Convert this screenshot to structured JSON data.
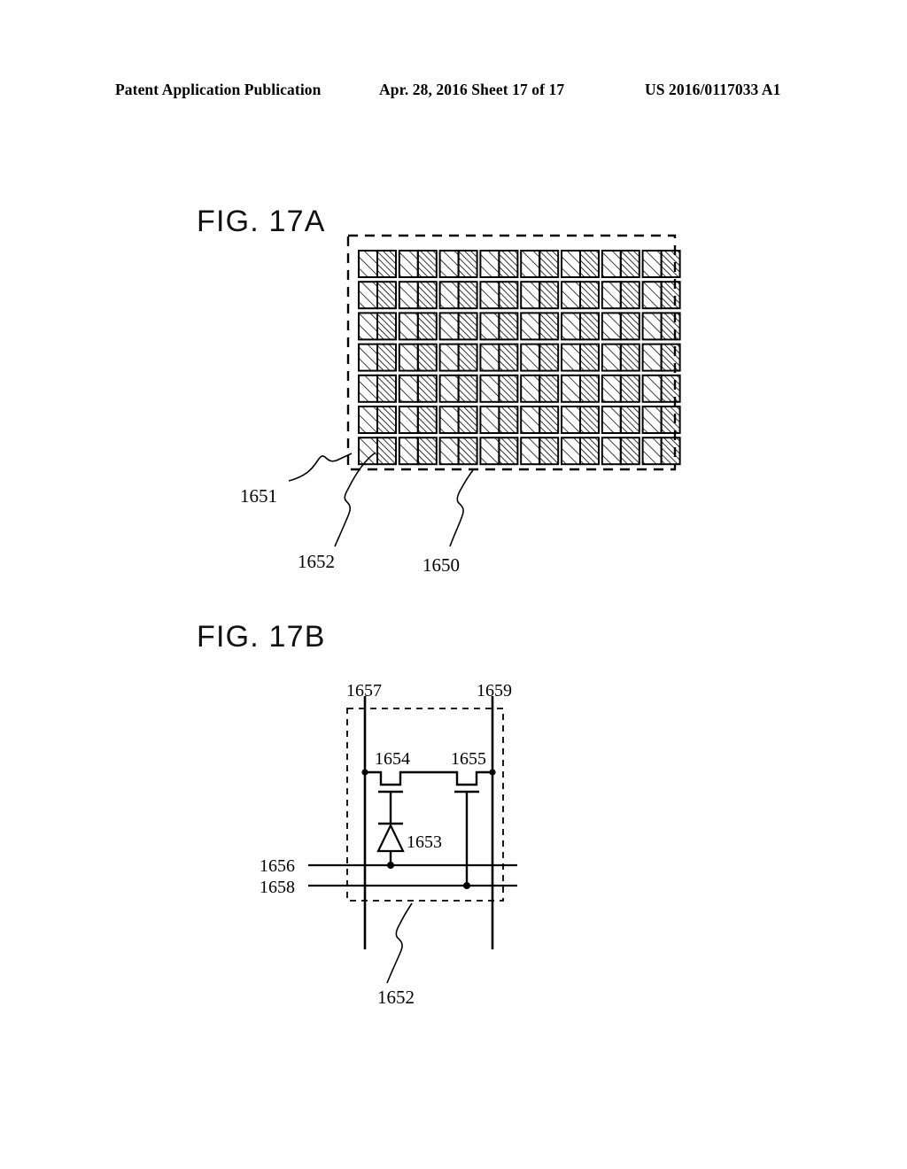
{
  "header": {
    "left": "Patent Application Publication",
    "middle": "Apr. 28, 2016  Sheet 17 of 17",
    "right": "US 2016/0117033 A1"
  },
  "figures": [
    {
      "id": "fig-17a",
      "title": "FIG. 17A",
      "type": "pixel-array-plan-view",
      "array": {
        "rows": 7,
        "cols": 8
      },
      "labels": [
        {
          "name": "ref-1651",
          "text": "1651"
        },
        {
          "name": "ref-1652",
          "text": "1652"
        },
        {
          "name": "ref-1650",
          "text": "1650"
        }
      ]
    },
    {
      "id": "fig-17b",
      "title": "FIG. 17B",
      "type": "pixel-circuit-diagram",
      "labels": [
        {
          "name": "ref-1657",
          "text": "1657"
        },
        {
          "name": "ref-1659",
          "text": "1659"
        },
        {
          "name": "ref-1654",
          "text": "1654"
        },
        {
          "name": "ref-1655",
          "text": "1655"
        },
        {
          "name": "ref-1653",
          "text": "1653"
        },
        {
          "name": "ref-1656",
          "text": "1656"
        },
        {
          "name": "ref-1658",
          "text": "1658"
        },
        {
          "name": "ref-1652",
          "text": "1652"
        }
      ]
    }
  ],
  "colors": {
    "ink": "#000000",
    "paper": "#ffffff"
  }
}
